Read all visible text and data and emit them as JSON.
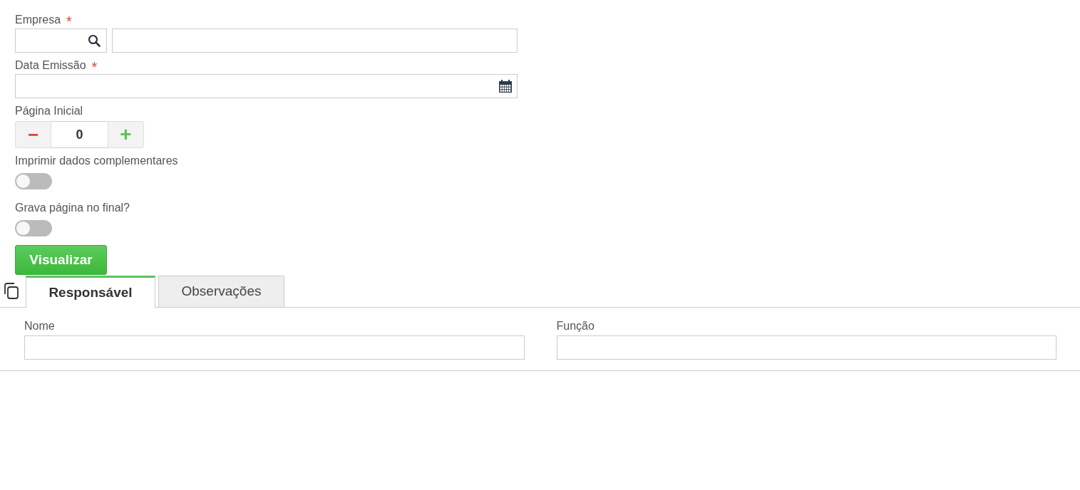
{
  "form": [
    {
      "kind": "lookup",
      "label": "Empresa",
      "required": true
    },
    {
      "kind": "date",
      "label": "Data Emissão",
      "required": true
    },
    {
      "kind": "stepper",
      "label": "Página Inicial",
      "required": false,
      "value": "0",
      "minus": "−",
      "plus": "+"
    },
    {
      "kind": "toggle",
      "label": "Imprimir dados complementares",
      "required": false,
      "on": false
    },
    {
      "kind": "toggle",
      "label": "Grava página no final?",
      "required": false,
      "on": false
    }
  ],
  "required_mark": "*",
  "submit_button": "Visualizar",
  "tabs": [
    {
      "label": "Responsável",
      "selected": true
    },
    {
      "label": "Observações",
      "selected": false
    }
  ],
  "tab_fields": [
    {
      "label": "Nome"
    },
    {
      "label": "Função"
    }
  ]
}
